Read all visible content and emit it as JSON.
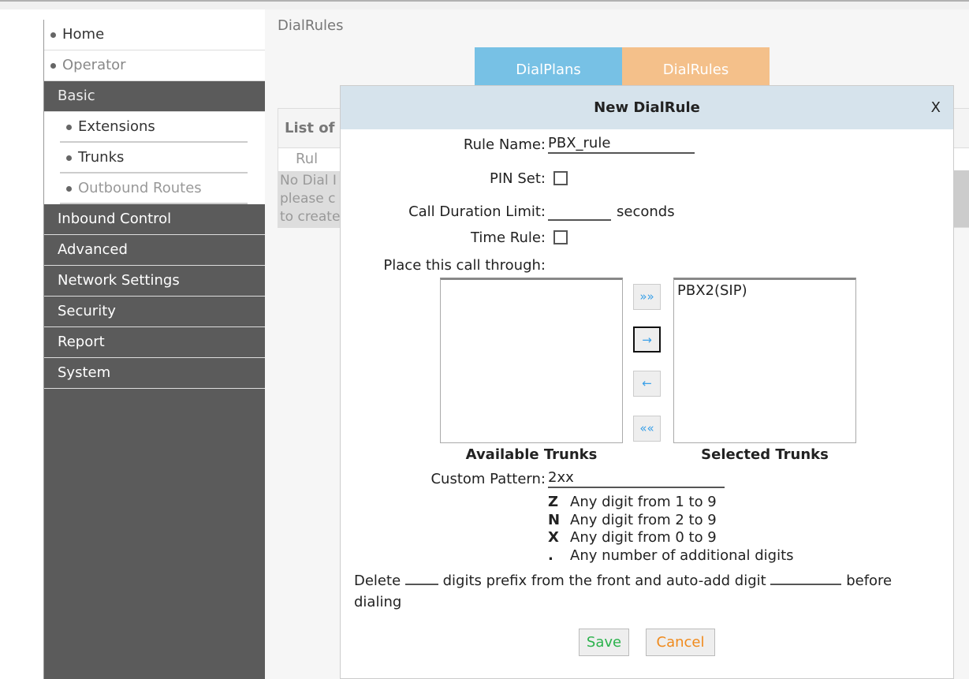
{
  "sidebar": {
    "items": [
      {
        "label": "Home"
      },
      {
        "label": "Operator"
      },
      {
        "label": "Basic"
      },
      {
        "label": "Extensions"
      },
      {
        "label": "Trunks"
      },
      {
        "label": "Outbound Routes"
      },
      {
        "label": "Inbound Control"
      },
      {
        "label": "Advanced"
      },
      {
        "label": "Network Settings"
      },
      {
        "label": "Security"
      },
      {
        "label": "Report"
      },
      {
        "label": "System"
      }
    ]
  },
  "main": {
    "breadcrumb": "DialRules",
    "tabs": [
      {
        "label": "DialPlans",
        "color": "#77c1e5"
      },
      {
        "label": "DialRules",
        "color": "#f4c08a"
      }
    ],
    "table": {
      "title": "List of",
      "col": "Rul",
      "empty": [
        "No Dial I",
        "please c",
        "to create"
      ]
    }
  },
  "modal": {
    "title": "New DialRule",
    "close": "X",
    "rule_name_label": "Rule Name:",
    "rule_name": "PBX_rule",
    "pin_label": "PIN Set:",
    "pin_checked": false,
    "duration_label": "Call Duration Limit:",
    "duration": "",
    "duration_unit": "seconds",
    "time_rule_label": "Time Rule:",
    "time_rule_checked": false,
    "through_label": "Place this call through:",
    "available_label": "Available Trunks",
    "available": [],
    "selected_label": "Selected Trunks",
    "selected": [
      "PBX2(SIP)"
    ],
    "move_buttons": {
      "add_all": "»»",
      "add": "→",
      "remove": "←",
      "remove_all": "««"
    },
    "pattern_label": "Custom Pattern:",
    "pattern": "2xx",
    "legend": [
      {
        "k": "Z",
        "v": "Any digit from 1 to 9"
      },
      {
        "k": "N",
        "v": "Any digit from 2 to 9"
      },
      {
        "k": "X",
        "v": "Any digit from 0 to 9"
      },
      {
        "k": ".",
        "v": "Any number of additional digits"
      }
    ],
    "delete_pre": "Delete",
    "delete_mid": "digits prefix from the front and auto-add digit",
    "delete_post": "before",
    "delete_end": "dialing",
    "save": "Save",
    "cancel": "Cancel"
  }
}
